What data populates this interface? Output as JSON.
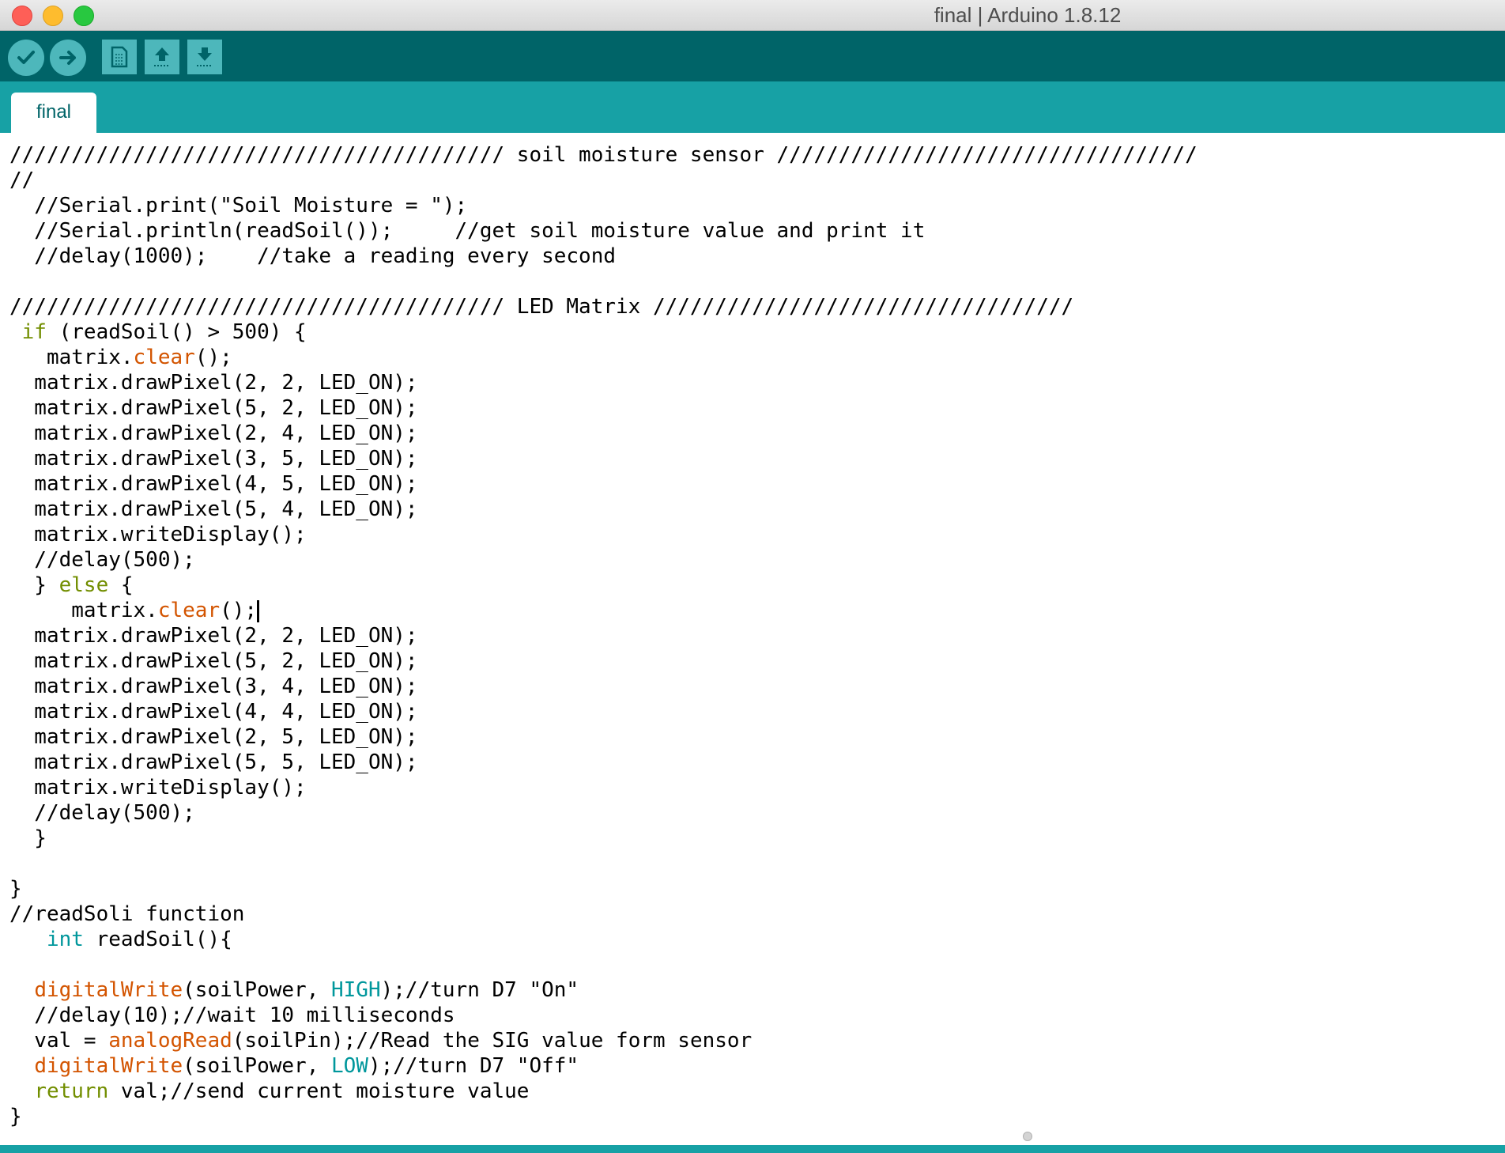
{
  "window": {
    "title": "final | Arduino 1.8.12"
  },
  "toolbar": {
    "buttons": [
      {
        "name": "verify",
        "icon": "checkmark-icon"
      },
      {
        "name": "upload",
        "icon": "arrow-right-icon"
      },
      {
        "name": "new",
        "icon": "new-file-icon"
      },
      {
        "name": "open",
        "icon": "arrow-up-icon"
      },
      {
        "name": "save",
        "icon": "arrow-down-icon"
      }
    ]
  },
  "tabs": [
    {
      "label": "final",
      "active": true
    }
  ],
  "colors": {
    "toolbar_bg": "#006468",
    "tabbar_bg": "#17a1a5",
    "button_bg": "#4db7bb",
    "function_keyword": "#d35400",
    "control_keyword": "#728e00",
    "type_keyword": "#00979c"
  },
  "code": {
    "lines": [
      "//////////////////////////////////////// soil moisture sensor //////////////////////////////////",
      "//",
      "  //Serial.print(\"Soil Moisture = \");",
      "  //Serial.println(readSoil());     //get soil moisture value and print it",
      "  //delay(1000);    //take a reading every second",
      "",
      "//////////////////////////////////////// LED Matrix //////////////////////////////////",
      " if (readSoil() > 500) {",
      "   matrix.clear();",
      "  matrix.drawPixel(2, 2, LED_ON);",
      "  matrix.drawPixel(5, 2, LED_ON);",
      "  matrix.drawPixel(2, 4, LED_ON);",
      "  matrix.drawPixel(3, 5, LED_ON);",
      "  matrix.drawPixel(4, 5, LED_ON);",
      "  matrix.drawPixel(5, 4, LED_ON);",
      "  matrix.writeDisplay();",
      "  //delay(500);",
      "  } else {",
      "     matrix.clear();",
      "  matrix.drawPixel(2, 2, LED_ON);",
      "  matrix.drawPixel(5, 2, LED_ON);",
      "  matrix.drawPixel(3, 4, LED_ON);",
      "  matrix.drawPixel(4, 4, LED_ON);",
      "  matrix.drawPixel(2, 5, LED_ON);",
      "  matrix.drawPixel(5, 5, LED_ON);",
      "  matrix.writeDisplay();",
      "  //delay(500);",
      "  }",
      "",
      "}",
      "//readSoli function",
      "   int readSoil(){",
      "",
      "  digitalWrite(soilPower, HIGH);//turn D7 \"On\"",
      "  //delay(10);//wait 10 milliseconds",
      "  val = analogRead(soilPin);//Read the SIG value form sensor",
      "  digitalWrite(soilPower, LOW);//turn D7 \"Off\"",
      "  return val;//send current moisture value",
      "}"
    ]
  }
}
